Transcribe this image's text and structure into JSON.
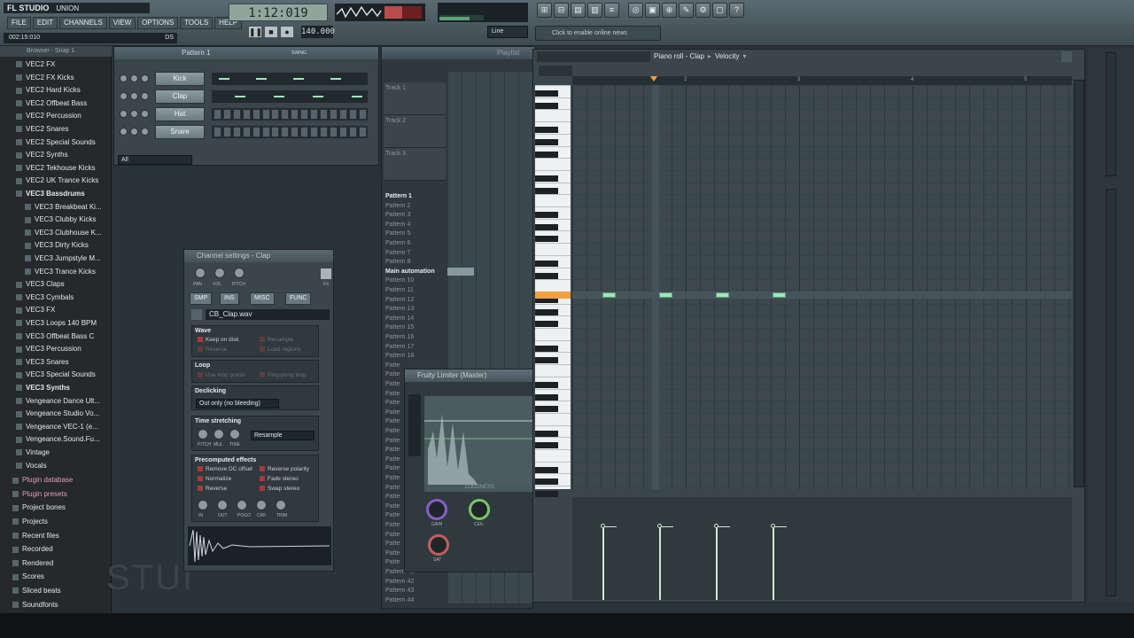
{
  "app": {
    "logo": "FL STUDIO",
    "project_name": "UNION"
  },
  "menu": [
    "FILE",
    "EDIT",
    "CHANNELS",
    "VIEW",
    "OPTIONS",
    "TOOLS",
    "HELP"
  ],
  "hint_time": "002:15:010",
  "hint_right": "DS",
  "transport": {
    "time": "1:12:019",
    "tempo": "140.000",
    "line_mode": "Line"
  },
  "news": "Click to enable online news",
  "browser": {
    "title": "Browser - Snap 1",
    "items": [
      {
        "label": "VEC2 FX",
        "bold": false
      },
      {
        "label": "VEC2 FX Kicks",
        "bold": false
      },
      {
        "label": "VEC2 Hard Kicks",
        "bold": false
      },
      {
        "label": "VEC2 Offbeat Bass",
        "bold": false
      },
      {
        "label": "VEC2 Percussion",
        "bold": false
      },
      {
        "label": "VEC2 Snares",
        "bold": false
      },
      {
        "label": "VEC2 Special Sounds",
        "bold": false
      },
      {
        "label": "VEC2 Synths",
        "bold": false
      },
      {
        "label": "VEC2 Tekhouse Kicks",
        "bold": false
      },
      {
        "label": "VEC2 UK Trance Kicks",
        "bold": false
      },
      {
        "label": "VEC3 Bassdrums",
        "bold": true
      },
      {
        "label": "VEC3 Breakbeat Ki...",
        "bold": false,
        "indent": true
      },
      {
        "label": "VEC3 Clubby Kicks",
        "bold": false,
        "indent": true
      },
      {
        "label": "VEC3 Clubhouse K...",
        "bold": false,
        "indent": true
      },
      {
        "label": "VEC3 Dirty Kicks",
        "bold": false,
        "indent": true
      },
      {
        "label": "VEC3 Jumpstyle M...",
        "bold": false,
        "indent": true
      },
      {
        "label": "VEC3 Trance Kicks",
        "bold": false,
        "indent": true
      },
      {
        "label": "VEC3 Claps",
        "bold": false
      },
      {
        "label": "VEC3 Cymbals",
        "bold": false
      },
      {
        "label": "VEC3 FX",
        "bold": false
      },
      {
        "label": "VEC3 Loops 140 BPM",
        "bold": false
      },
      {
        "label": "VEC3 Offbeat Bass C",
        "bold": false
      },
      {
        "label": "VEC3 Percussion",
        "bold": false
      },
      {
        "label": "VEC3 Snares",
        "bold": false
      },
      {
        "label": "VEC3 Special Sounds",
        "bold": false
      },
      {
        "label": "VEC3 Synths",
        "bold": true
      },
      {
        "label": "Vengeance Dance Ult...",
        "bold": false
      },
      {
        "label": "Vengeance Studio Vo...",
        "bold": false
      },
      {
        "label": "Vengeance VEC-1 (e...",
        "bold": false
      },
      {
        "label": "Vengeance.Sound.Fu...",
        "bold": false
      },
      {
        "label": "Vintage",
        "bold": false
      },
      {
        "label": "Vocals",
        "bold": false
      }
    ],
    "roots": [
      {
        "label": "Plugin database",
        "special": true
      },
      {
        "label": "Plugin presets",
        "special": true
      },
      {
        "label": "Project bones",
        "special": false
      },
      {
        "label": "Projects",
        "special": false
      },
      {
        "label": "Recent files",
        "special": false
      },
      {
        "label": "Recorded",
        "special": false
      },
      {
        "label": "Rendered",
        "special": false
      },
      {
        "label": "Scores",
        "special": false
      },
      {
        "label": "Sliced beats",
        "special": false
      },
      {
        "label": "Soundfonts",
        "special": false
      }
    ]
  },
  "step_sequencer": {
    "title": "Pattern 1",
    "swing_label": "SWING",
    "filter": "All",
    "channels": [
      {
        "name": "Kick",
        "mode": "piano"
      },
      {
        "name": "Clap",
        "mode": "piano"
      },
      {
        "name": "Hat",
        "mode": "steps"
      },
      {
        "name": "Snare",
        "mode": "steps"
      }
    ]
  },
  "channel_settings": {
    "title": "Channel settings - Clap",
    "knobs": [
      "PAN",
      "VOL",
      "PITCH"
    ],
    "fx_label": "FX",
    "tabs": [
      "SMP",
      "INS",
      "MISC",
      "FUNC"
    ],
    "sample": "CB_Clap.wav",
    "wave_header": "Wave",
    "wave_opts": [
      {
        "label": "Keep on disk",
        "on": true
      },
      {
        "label": "Resample",
        "on": false
      },
      {
        "label": "Reverse",
        "on": false
      },
      {
        "label": "Load regions",
        "on": false
      }
    ],
    "loop_header": "Loop",
    "loop_opts": [
      {
        "label": "Use loop points",
        "on": false
      },
      {
        "label": "Ping-pong loop",
        "on": false
      }
    ],
    "declick_header": "Declicking",
    "declick_mode": "Out only (no bleeding)",
    "ts_header": "Time stretching",
    "ts_knobs": [
      "PITCH",
      "MUL",
      "TIME"
    ],
    "ts_mode": "Resample",
    "pre_header": "Precomputed effects",
    "pre_opts": [
      {
        "label": "Remove DC offset",
        "on": true
      },
      {
        "label": "Reverse polarity",
        "on": true
      },
      {
        "label": "Normalize",
        "on": true
      },
      {
        "label": "Fade stereo",
        "on": true
      },
      {
        "label": "Reverse",
        "on": true
      },
      {
        "label": "Swap stereo",
        "on": true
      }
    ],
    "pre_knobs": [
      "IN",
      "OUT",
      "POGO",
      "CRF",
      "TRIM"
    ]
  },
  "playlist": {
    "title": "Playlist",
    "tracks": [
      "Track 1",
      "Track 2",
      "Track 3"
    ],
    "patterns": [
      "Pattern 1",
      "Pattern 2",
      "Pattern 3",
      "Pattern 4",
      "Pattern 5",
      "Pattern 6",
      "Pattern 7",
      "Pattern 8",
      "Main automation",
      "Pattern 10",
      "Pattern 11",
      "Pattern 12",
      "Pattern 13",
      "Pattern 14",
      "Pattern 15",
      "Pattern 16",
      "Pattern 17",
      "Pattern 18",
      "Patte",
      "Patte",
      "Patte",
      "Patte",
      "Patte",
      "Patte",
      "Patte",
      "Patte",
      "Patte",
      "Patte",
      "Patte",
      "Patte",
      "Patte",
      "Patte",
      "Patte",
      "Patte",
      "Patte",
      "Patte",
      "Patte",
      "Patte",
      "Patte",
      "Patte",
      "Pattern 41",
      "Pattern 42",
      "Pattern 43",
      "Pattern 44"
    ]
  },
  "limiter": {
    "title": "Fruity Limiter (Master)",
    "section": "LOUDNESS",
    "knobs": [
      "GAIN",
      "CEIL",
      "SAT"
    ]
  },
  "piano_roll": {
    "title": "Piano roll - Clap",
    "target": "Velocity",
    "bars": [
      "2",
      "3",
      "4",
      "5"
    ],
    "notes": [
      {
        "start": 0.25,
        "length": 0.1
      },
      {
        "start": 0.75,
        "length": 0.1
      },
      {
        "start": 1.25,
        "length": 0.1
      },
      {
        "start": 1.75,
        "length": 0.1
      }
    ],
    "velocities": [
      {
        "pos": 0.25,
        "value": 0.78
      },
      {
        "pos": 0.75,
        "value": 0.78
      },
      {
        "pos": 1.25,
        "value": 0.78
      },
      {
        "pos": 1.75,
        "value": 0.78
      }
    ]
  },
  "watermark": "STUI"
}
